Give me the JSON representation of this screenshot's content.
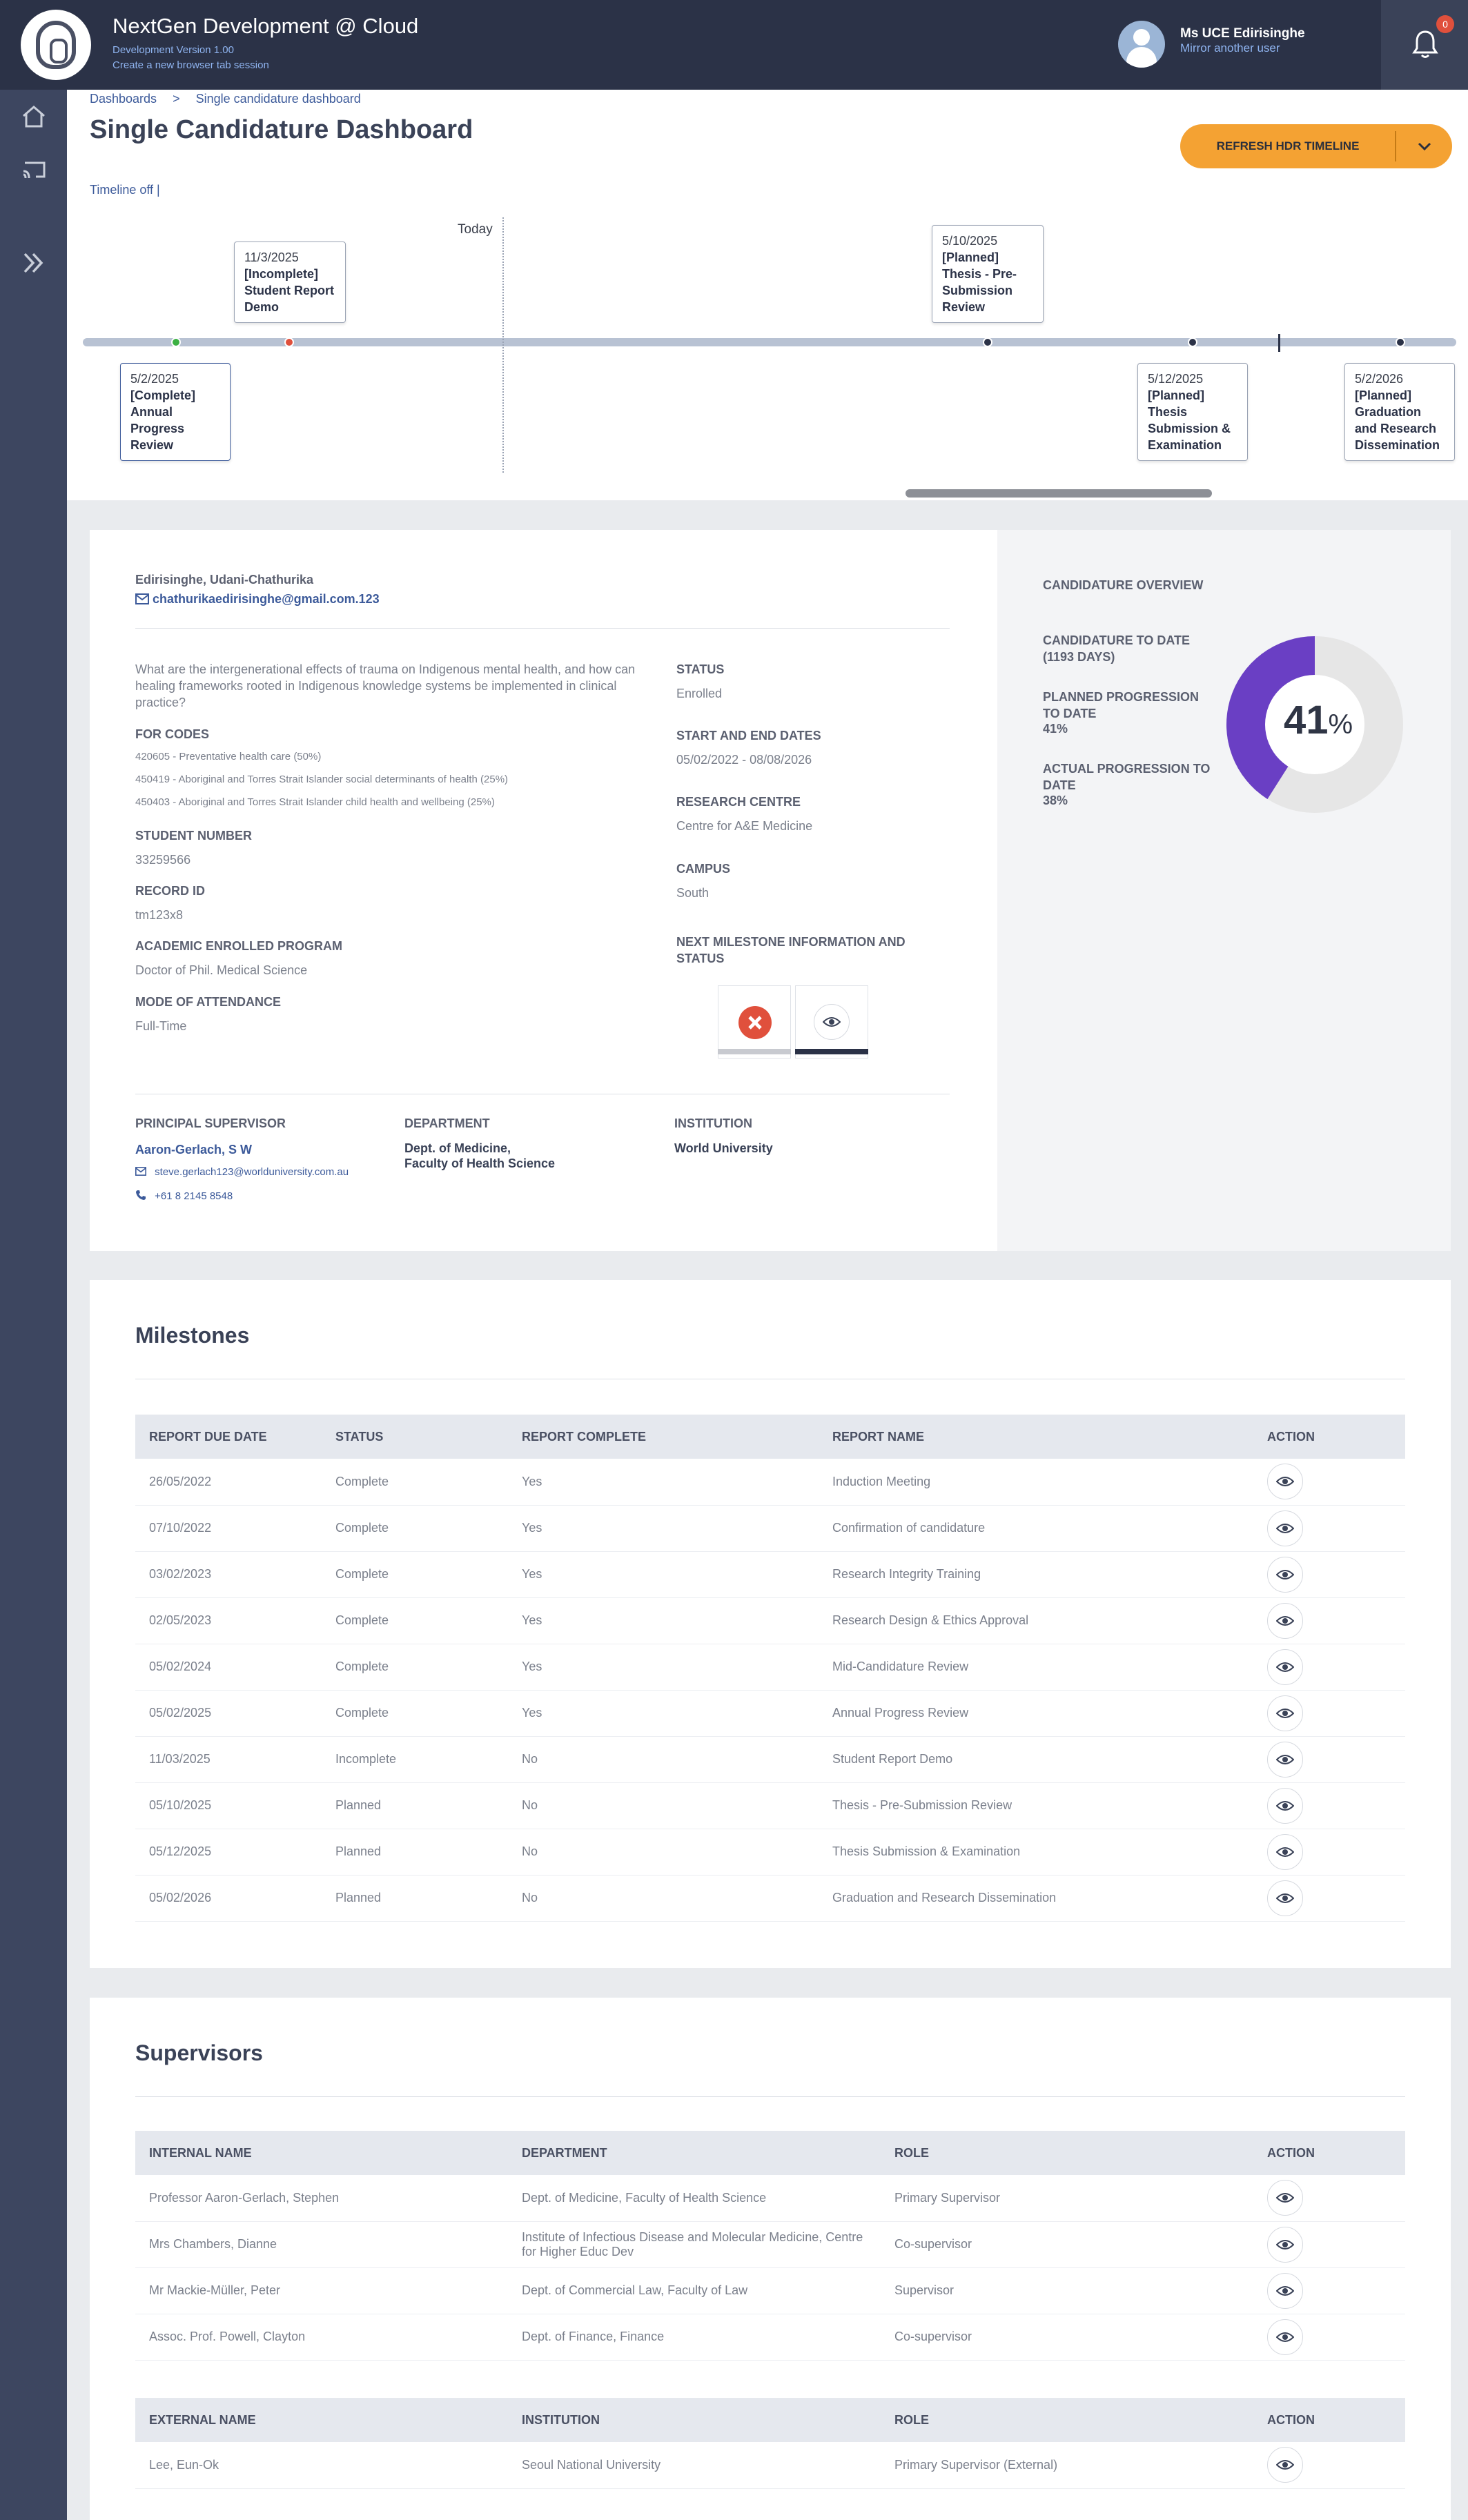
{
  "app": {
    "title": "NextGen Development @ Cloud",
    "version": "Development Version 1.00",
    "new_tab": "Create a new browser tab session"
  },
  "user": {
    "name": "Ms UCE Edirisinghe",
    "mirror": "Mirror another user"
  },
  "notifications": {
    "count": "0"
  },
  "breadcrumb": [
    "Dashboards",
    ">",
    "Single candidature dashboard"
  ],
  "page_title": "Single Candidature Dashboard",
  "refresh_button": "REFRESH HDR TIMELINE",
  "timeline_toggle": "Timeline off |",
  "timeline": {
    "today": "Today",
    "cards": [
      {
        "date": "5/2/2025",
        "title": "[Complete] Annual Progress Review"
      },
      {
        "date": "11/3/2025",
        "title": "[Incomplete] Student Report Demo"
      },
      {
        "date": "5/10/2025",
        "title": "[Planned] Thesis - Pre-Submission Review"
      },
      {
        "date": "5/12/2025",
        "title": "[Planned] Thesis Submission & Examination"
      },
      {
        "date": "5/2/2026",
        "title": "[Planned] Graduation and Research Dissemination"
      }
    ]
  },
  "candidate": {
    "name": "Edirisinghe, Udani-Chathurika",
    "email": "chathurikaedirisinghe@gmail.com.123",
    "research_question": "What are the intergenerational effects of trauma on Indigenous mental health, and how can healing frameworks rooted in Indigenous knowledge systems be implemented in clinical practice?",
    "for_codes_label": "FOR CODES",
    "for_codes": [
      "420605 - Preventative health care (50%)",
      "450419 - Aboriginal and Torres Strait Islander social determinants of health (25%)",
      "450403 - Aboriginal and Torres Strait Islander child health and wellbeing (25%)"
    ],
    "student_number_label": "STUDENT NUMBER",
    "student_number": "33259566",
    "record_id_label": "RECORD ID",
    "record_id": "tm123x8",
    "program_label": "ACADEMIC ENROLLED PROGRAM",
    "program": "Doctor of Phil. Medical Science",
    "attendance_label": "MODE OF ATTENDANCE",
    "attendance": "Full-Time",
    "status_label": "STATUS",
    "status": "Enrolled",
    "dates_label": "START AND END DATES",
    "dates": "05/02/2022 - 08/08/2026",
    "centre_label": "RESEARCH CENTRE",
    "centre": "Centre for A&E Medicine",
    "campus_label": "CAMPUS",
    "campus": "South",
    "next_milestone_label": "NEXT MILESTONE INFORMATION AND STATUS",
    "supervisor_label": "PRINCIPAL SUPERVISOR",
    "supervisor_name": "Aaron-Gerlach, S W",
    "supervisor_email": "steve.gerlach123@worlduniversity.com.au",
    "supervisor_phone": "+61 8 2145 8548",
    "department_label": "DEPARTMENT",
    "department_line1": "Dept. of Medicine,",
    "department_line2": "Faculty of Health Science",
    "institution_label": "INSTITUTION",
    "institution": "World University"
  },
  "overview": {
    "title": "CANDIDATURE OVERVIEW",
    "to_date_label": "CANDIDATURE TO DATE",
    "to_date_value": "(1193 DAYS)",
    "planned_label": "PLANNED PROGRESSION TO DATE",
    "planned_value": "41%",
    "actual_label": "ACTUAL PROGRESSION TO DATE",
    "actual_value": "38%",
    "donut_number": "41",
    "donut_unit": "%",
    "donut_fraction": 0.41,
    "donut_color": "#6a3fc4"
  },
  "milestones": {
    "title": "Milestones",
    "headers": [
      "REPORT DUE DATE",
      "STATUS",
      "REPORT COMPLETE",
      "REPORT NAME",
      "ACTION"
    ],
    "rows": [
      [
        "26/05/2022",
        "Complete",
        "Yes",
        "Induction Meeting"
      ],
      [
        "07/10/2022",
        "Complete",
        "Yes",
        "Confirmation of candidature"
      ],
      [
        "03/02/2023",
        "Complete",
        "Yes",
        "Research Integrity Training"
      ],
      [
        "02/05/2023",
        "Complete",
        "Yes",
        "Research Design & Ethics Approval"
      ],
      [
        "05/02/2024",
        "Complete",
        "Yes",
        "Mid-Candidature Review"
      ],
      [
        "05/02/2025",
        "Complete",
        "Yes",
        "Annual Progress Review"
      ],
      [
        "11/03/2025",
        "Incomplete",
        "No",
        "Student Report Demo"
      ],
      [
        "05/10/2025",
        "Planned",
        "No",
        "Thesis - Pre-Submission Review"
      ],
      [
        "05/12/2025",
        "Planned",
        "No",
        "Thesis Submission & Examination"
      ],
      [
        "05/02/2026",
        "Planned",
        "No",
        "Graduation and Research Dissemination"
      ]
    ]
  },
  "supervisors": {
    "title": "Supervisors",
    "internal_headers": [
      "INTERNAL NAME",
      "DEPARTMENT",
      "ROLE",
      "ACTION"
    ],
    "internal_rows": [
      [
        "Professor Aaron-Gerlach, Stephen",
        "Dept. of Medicine, Faculty of Health Science",
        "Primary Supervisor"
      ],
      [
        "Mrs Chambers, Dianne",
        "Institute of Infectious Disease and Molecular Medicine, Centre for Higher Educ Dev",
        "Co-supervisor"
      ],
      [
        "Mr Mackie-Müller, Peter",
        "Dept. of Commercial Law, Faculty of Law",
        "Supervisor"
      ],
      [
        "Assoc. Prof. Powell, Clayton",
        "Dept. of Finance, Finance",
        "Co-supervisor"
      ]
    ],
    "external_headers": [
      "EXTERNAL NAME",
      "INSTITUTION",
      "ROLE",
      "ACTION"
    ],
    "external_rows": [
      [
        "Lee, Eun-Ok",
        "Seoul National University",
        "Primary Supervisor (External)"
      ]
    ]
  }
}
